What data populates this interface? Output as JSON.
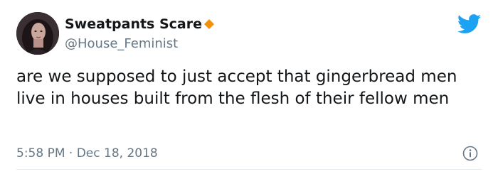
{
  "author": {
    "display_name": "Sweatpants Scare",
    "handle": "@House_Feminist",
    "badge_icon": "orange-diamond-icon",
    "badge_color": "#f4900c"
  },
  "brand": {
    "icon": "twitter-bird-icon",
    "color": "#1da1f2"
  },
  "tweet": {
    "text": "are we supposed to just accept that gingerbread men live in houses built from the flesh of their fellow men",
    "time": "5:58 PM",
    "separator": "·",
    "date": "Dec 18, 2018"
  },
  "footer": {
    "info_icon": "info-circle-icon"
  }
}
